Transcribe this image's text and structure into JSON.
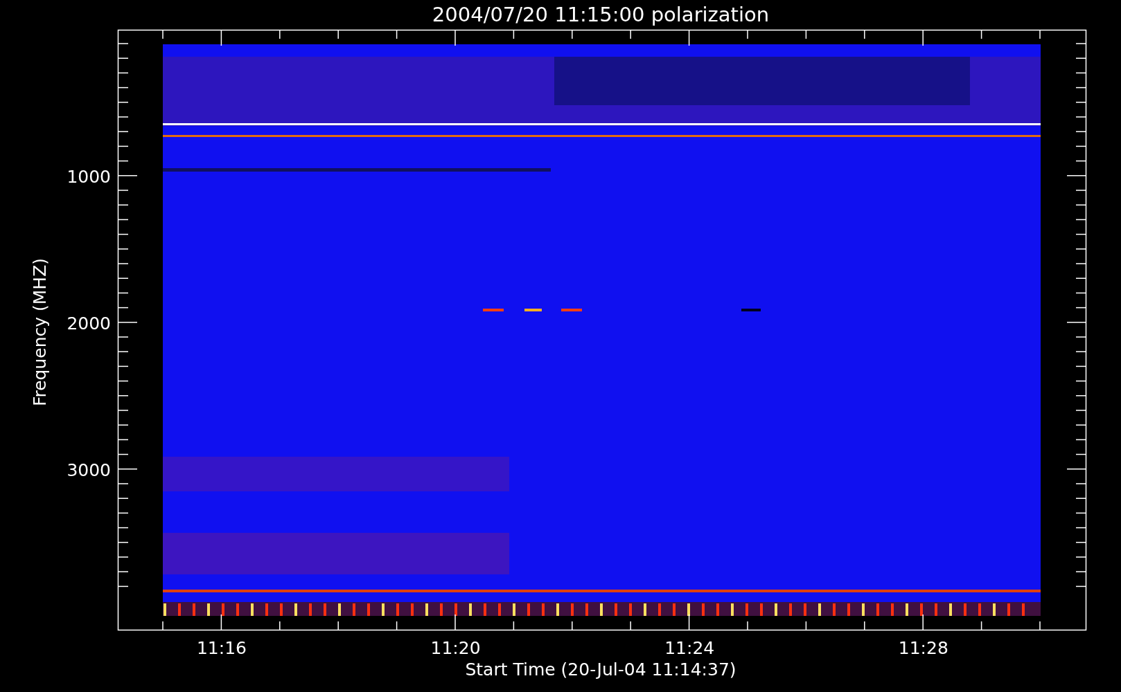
{
  "title": "2004/07/20 11:15:00 polarization",
  "x_axis": {
    "label": "Start Time (20-Jul-04 11:14:37)",
    "ticks": [
      "11:16",
      "11:20",
      "11:24",
      "11:28"
    ]
  },
  "y_axis": {
    "label": "Frequency (MHZ)",
    "ticks": [
      "1000",
      "2000",
      "3000"
    ]
  }
}
